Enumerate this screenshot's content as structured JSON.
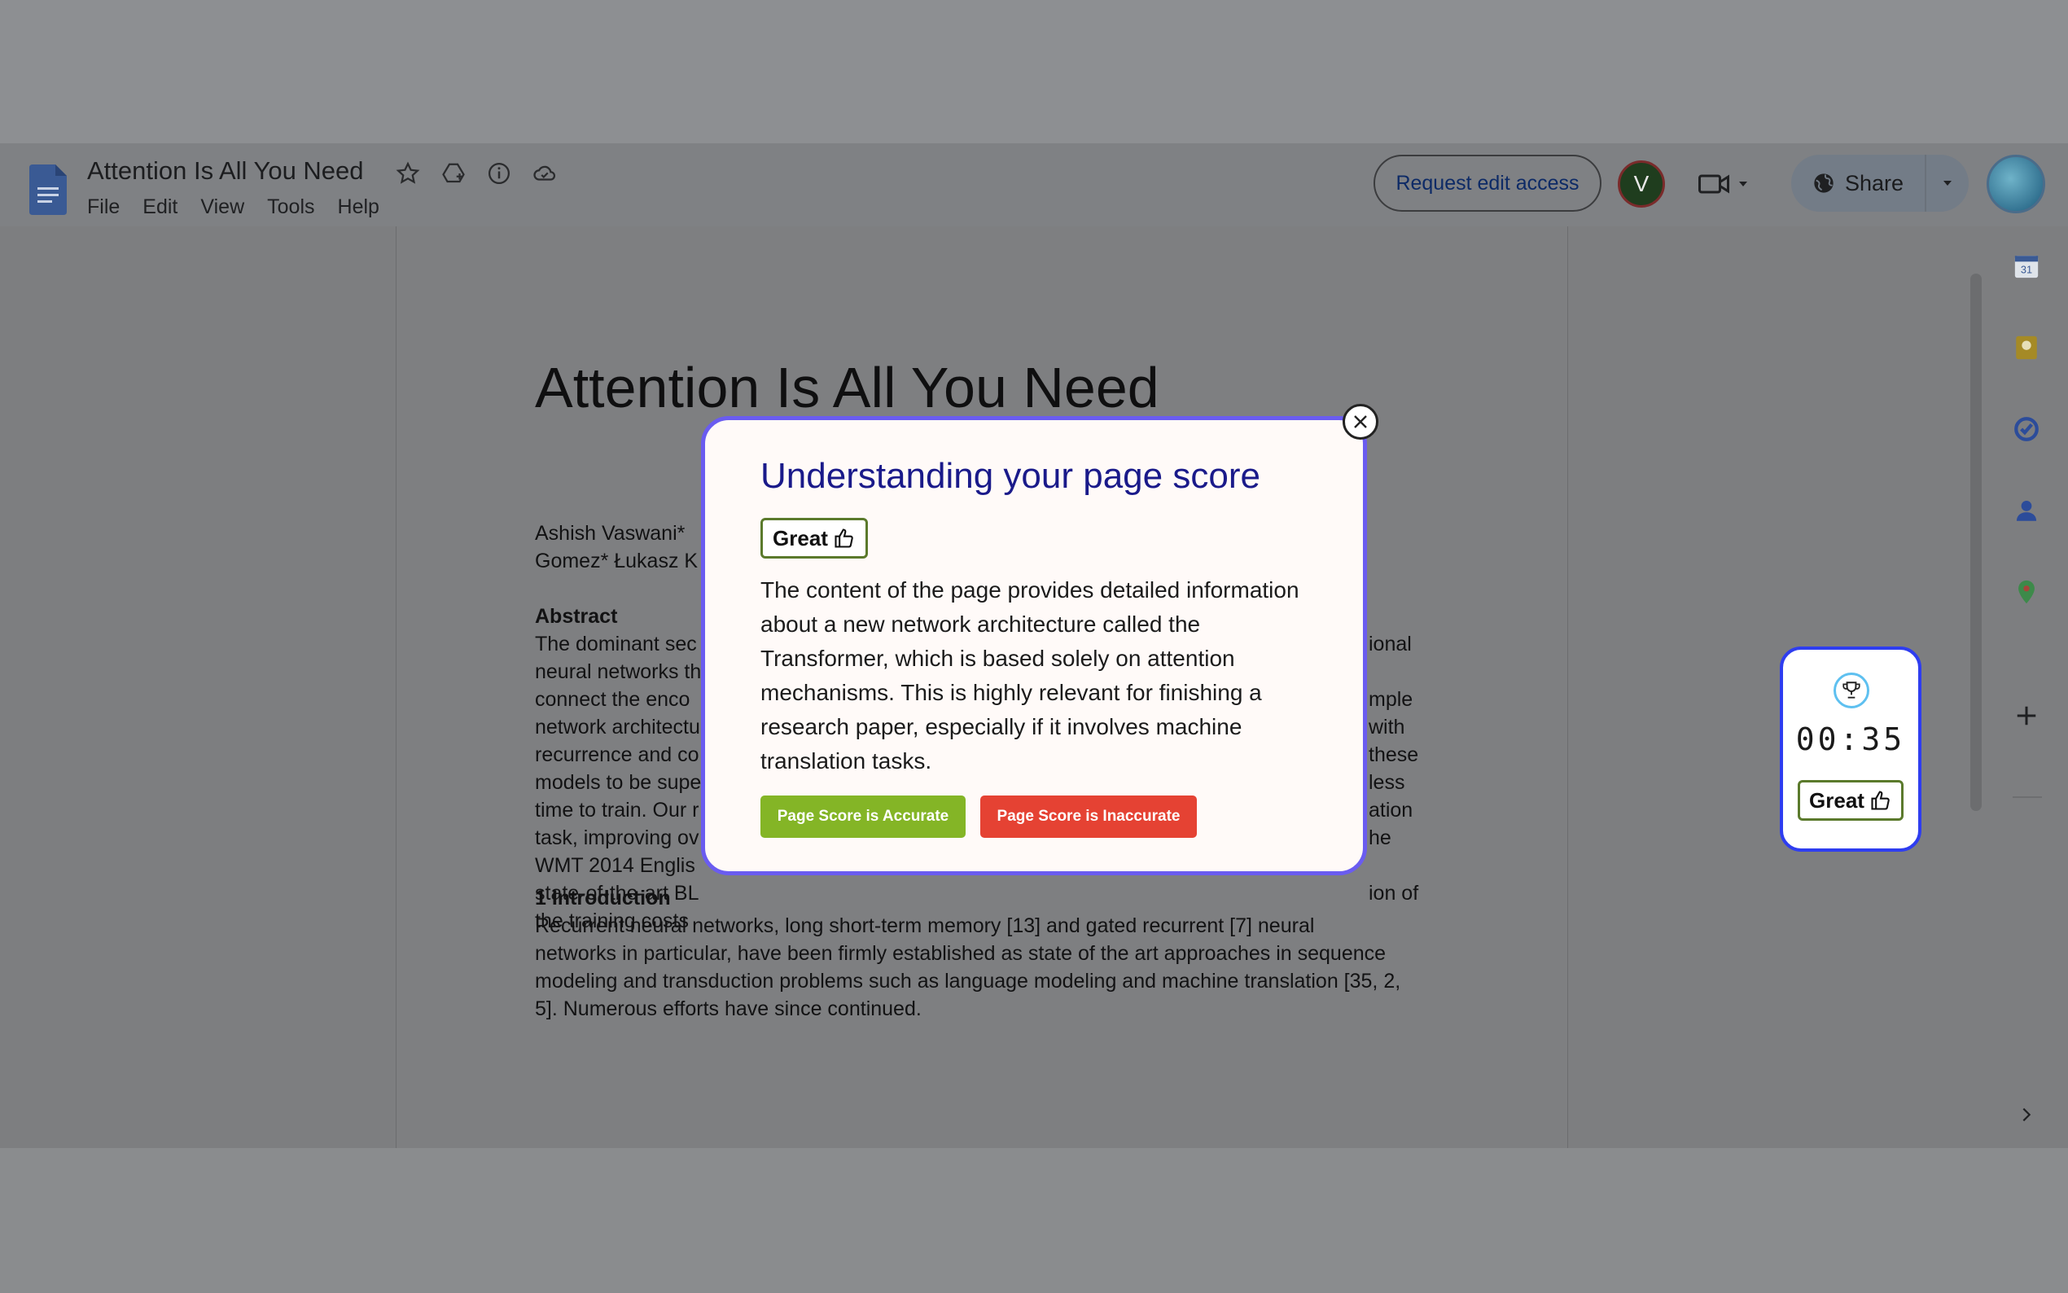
{
  "app": {
    "title": "Attention Is All You Need",
    "menu": [
      "File",
      "Edit",
      "View",
      "Tools",
      "Help"
    ],
    "request_edit_label": "Request edit access",
    "avatar_initial": "V",
    "share_label": "Share"
  },
  "document": {
    "title": "Attention Is All You Need",
    "authors_line1": "Ashish Vaswani*",
    "authors_line2": "Gomez* Łukasz K",
    "abstract_heading": "Abstract",
    "abstract_lines": [
      "The dominant sec",
      "neural networks th",
      "connect the enco",
      "network architectu",
      "recurrence and co",
      "models to be supe",
      "time to train. Our r",
      "task, improving ov",
      "WMT 2014 Englis",
      "state-of-the-art BL",
      "the training costs"
    ],
    "abstract_right_fragments": [
      "ional",
      "",
      "mple",
      "with",
      "these",
      "less",
      "ation",
      "he",
      "",
      "ion of",
      ""
    ],
    "intro_heading": "1 Introduction",
    "intro_lines": [
      "Recurrent neural networks, long short-term memory [13] and gated recurrent [7] neural",
      "networks in particular, have been firmly established as state of the art approaches in sequence",
      "modeling and transduction problems such as language modeling and machine translation [35, 2,",
      "5]. Numerous efforts have since continued."
    ]
  },
  "widget": {
    "timer": "00:35",
    "badge_label": "Great"
  },
  "modal": {
    "title": "Understanding your page score",
    "badge_label": "Great",
    "body": "The content of the page provides detailed information about a new network architecture called the Transformer, which is based solely on attention mechanisms. This is highly relevant for finishing a research paper, especially if it involves machine translation tasks.",
    "accurate_label": "Page Score is Accurate",
    "inaccurate_label": "Page Score is Inaccurate"
  },
  "colors": {
    "modal_title": "#1a1a8a",
    "modal_border": "#6a5cf0",
    "accurate_btn": "#84b526",
    "inaccurate_btn": "#e54233",
    "widget_border": "#2e3df0"
  }
}
